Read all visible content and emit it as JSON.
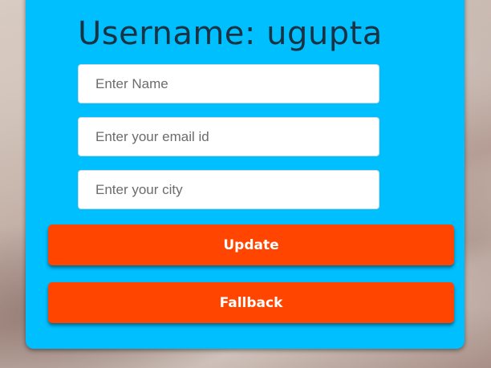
{
  "form": {
    "title": "Username: ugupta",
    "fields": [
      {
        "placeholder": "Enter Name",
        "value": ""
      },
      {
        "placeholder": "Enter your email id",
        "value": ""
      },
      {
        "placeholder": "Enter your city",
        "value": ""
      }
    ],
    "buttons": {
      "update_label": "Update",
      "fallback_label": "Fallback"
    }
  },
  "colors": {
    "card_background": "#00bfff",
    "button_background": "#ff4500",
    "title_text": "#1a3344"
  }
}
